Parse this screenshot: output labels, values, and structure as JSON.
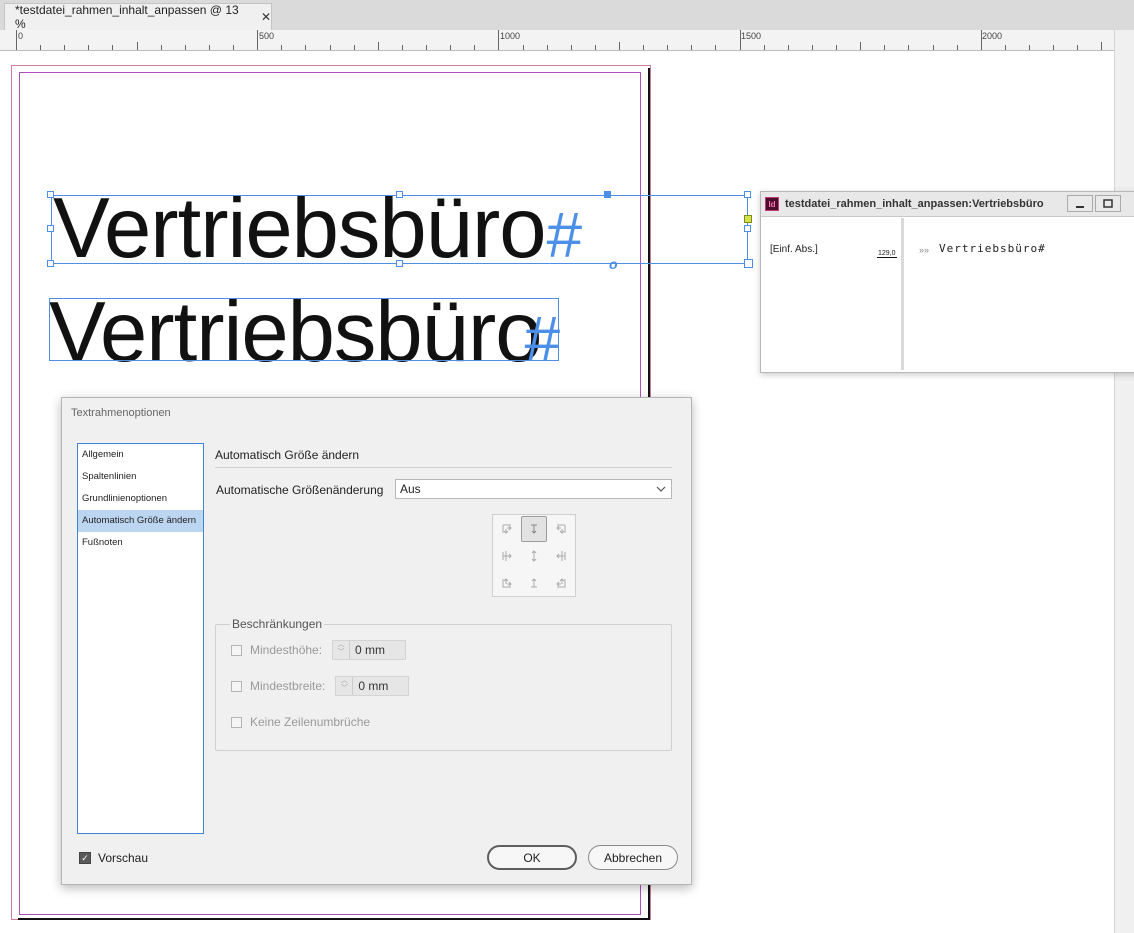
{
  "tab": {
    "title": "*testdatei_rahmen_inhalt_anpassen @ 13 %",
    "close": "✕"
  },
  "ruler": {
    "labels": [
      "0",
      "500",
      "1000",
      "1500",
      "2000"
    ]
  },
  "canvas": {
    "line1": "Vertriebsbüro",
    "line2": "Vertriebsbüro",
    "pilcrow": "#",
    "overset": "o"
  },
  "story_editor": {
    "title": "testdatei_rahmen_inhalt_anpassen:Vertriebsbüro",
    "app_icon": "Id",
    "paragraph_style": "[Einf. Abs.]",
    "depth": "129,0",
    "arrow": "»»",
    "text": "Vertriebsbüro#"
  },
  "dialog": {
    "title": "Textrahmenoptionen",
    "nav": [
      "Allgemein",
      "Spaltenlinien",
      "Grundlinienoptionen",
      "Automatisch Größe ändern",
      "Fußnoten"
    ],
    "active_nav_index": 3,
    "heading": "Automatisch Größe ändern",
    "auto_resize_label": "Automatische Größenänderung",
    "auto_resize_value": "Aus",
    "constraints_legend": "Beschränkungen",
    "min_height_label": "Mindesthöhe:",
    "min_height_value": "0 mm",
    "min_width_label": "Mindestbreite:",
    "min_width_value": "0 mm",
    "no_line_breaks_label": "Keine Zeilenumbrüche",
    "preview_label": "Vorschau",
    "ok": "OK",
    "cancel": "Abbrechen"
  }
}
